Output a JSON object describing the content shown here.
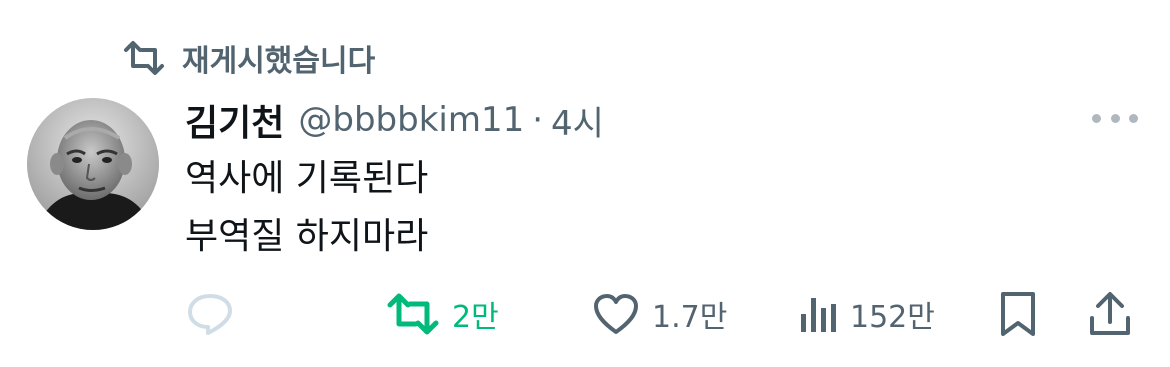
{
  "repost_context": {
    "icon": "retweet-icon",
    "label": "재게시했습니다"
  },
  "author": {
    "display_name": "김기천",
    "handle": "@bbbbkim11",
    "separator": "·",
    "timestamp": "4시"
  },
  "tweet": {
    "lines": [
      "역사에 기록된다",
      "부역질 하지마라"
    ]
  },
  "actions": {
    "reply": {
      "icon": "reply-icon",
      "count": ""
    },
    "retweet": {
      "icon": "retweet-icon",
      "count": "2만",
      "active_color": "#00ba7c"
    },
    "like": {
      "icon": "heart-icon",
      "count": "1.7만"
    },
    "views": {
      "icon": "views-icon",
      "count": "152만"
    },
    "bookmark": {
      "icon": "bookmark-icon"
    },
    "share": {
      "icon": "share-icon"
    }
  },
  "colors": {
    "text": "#0f1419",
    "secondary": "#536471",
    "retweet_active": "#00ba7c"
  }
}
